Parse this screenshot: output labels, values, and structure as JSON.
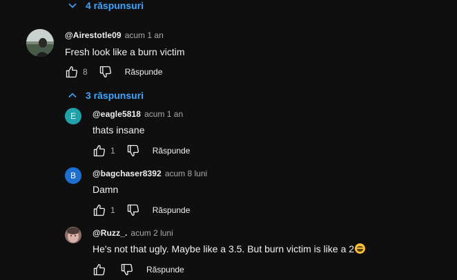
{
  "top_toggle": {
    "label": "4 răspunsuri",
    "icon": "chevron-down-icon"
  },
  "main_comment": {
    "author": "@Airestotle09",
    "time": "acum 1 an",
    "text": "Fresh look like a burn victim",
    "likes": "8",
    "reply_label": "Răspunde"
  },
  "replies_toggle": {
    "label": "3 răspunsuri",
    "icon": "chevron-up-icon"
  },
  "replies": [
    {
      "author": "@eagle5818",
      "time": "acum 1 an",
      "text": "thats insane",
      "likes": "1",
      "reply_label": "Răspunde",
      "avatar_letter": "E",
      "avatar_color": "#1fa3a9"
    },
    {
      "author": "@bagchaser8392",
      "time": "acum 8 luni",
      "text": "Damn",
      "likes": "1",
      "reply_label": "Răspunde",
      "avatar_letter": "B",
      "avatar_color": "#1e6fd1"
    },
    {
      "author": "@Ruzz_.",
      "time": "acum 2 luni",
      "text": "He's not that ugly. Maybe like a 3.5. But burn victim is like a 2",
      "emoji": "joy-emoji",
      "likes": "",
      "reply_label": "Răspunde"
    }
  ],
  "colors": {
    "background": "#0f0f0f",
    "link_blue": "#3ea6ff",
    "muted_text": "#aaaaaa"
  }
}
